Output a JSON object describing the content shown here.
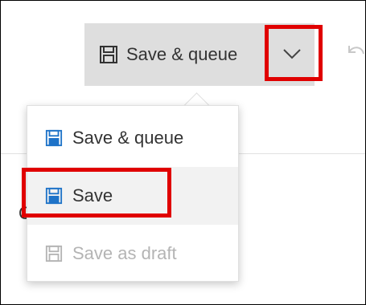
{
  "toolbar": {
    "save_queue_label": "Save & queue",
    "save_icon": "save-icon",
    "chevron_icon": "chevron-down-icon",
    "undo_icon": "undo-icon"
  },
  "menu": {
    "items": [
      {
        "label": "Save & queue",
        "icon": "save-icon",
        "state": "enabled"
      },
      {
        "label": "Save",
        "icon": "save-icon",
        "state": "hover"
      },
      {
        "label": "Save as draft",
        "icon": "save-icon",
        "state": "disabled"
      }
    ]
  },
  "colors": {
    "accent_blue": "#1e73c8",
    "highlight_red": "#e00000",
    "toolbar_bg": "#dedede",
    "disabled_gray": "#b4b4b4"
  }
}
